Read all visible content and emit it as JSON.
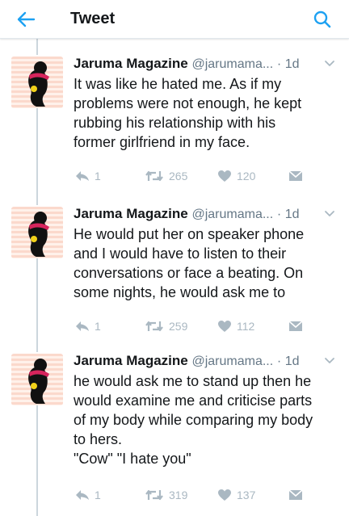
{
  "header": {
    "title": "Tweet",
    "back_icon": "back-arrow-icon",
    "search_icon": "search-icon",
    "accent_color": "#1da1f2"
  },
  "tweets": [
    {
      "name": "Jaruma Magazine",
      "handle": "@jarumama...",
      "time": "· 1d",
      "lines": [
        "It was like he hated me. As if my",
        "problems were not enough, he kept",
        "rubbing his relationship with his",
        "former girlfriend in my face."
      ],
      "replies": "1",
      "retweets": "265",
      "likes": "120"
    },
    {
      "name": "Jaruma Magazine",
      "handle": "@jarumama...",
      "time": "· 1d",
      "lines": [
        "He would put her on speaker phone",
        "and I would have to listen to their",
        "conversations or face a beating. On",
        "some nights, he would ask me to"
      ],
      "replies": "1",
      "retweets": "259",
      "likes": "112"
    },
    {
      "name": "Jaruma Magazine",
      "handle": "@jarumama...",
      "time": "· 1d",
      "lines": [
        "he would ask me to stand up then he",
        "would examine me and criticise parts",
        "of my body while comparing my body",
        "to hers.",
        "\"Cow\" \"I hate you\""
      ],
      "replies": "1",
      "retweets": "319",
      "likes": "137"
    }
  ]
}
